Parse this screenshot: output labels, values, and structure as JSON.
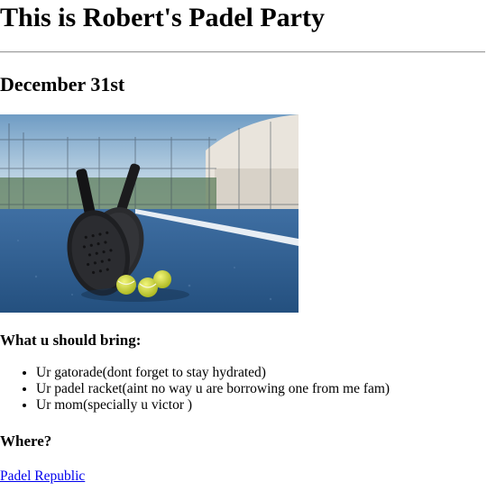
{
  "title": "This is Robert's Padel Party",
  "date": "December 31st",
  "bring": {
    "heading": "What u should bring:",
    "items": [
      "Ur gatorade(dont forget to stay hydrated)",
      "Ur padel racket(aint no way u are borrowing one from me fam)",
      "Ur mom(specially u victor )"
    ]
  },
  "where": {
    "heading": "Where?",
    "link_text": "Padel Republic"
  },
  "colors": {
    "link": "#0000ee",
    "court": "#2f5f92",
    "ball": "#d6e03a"
  }
}
